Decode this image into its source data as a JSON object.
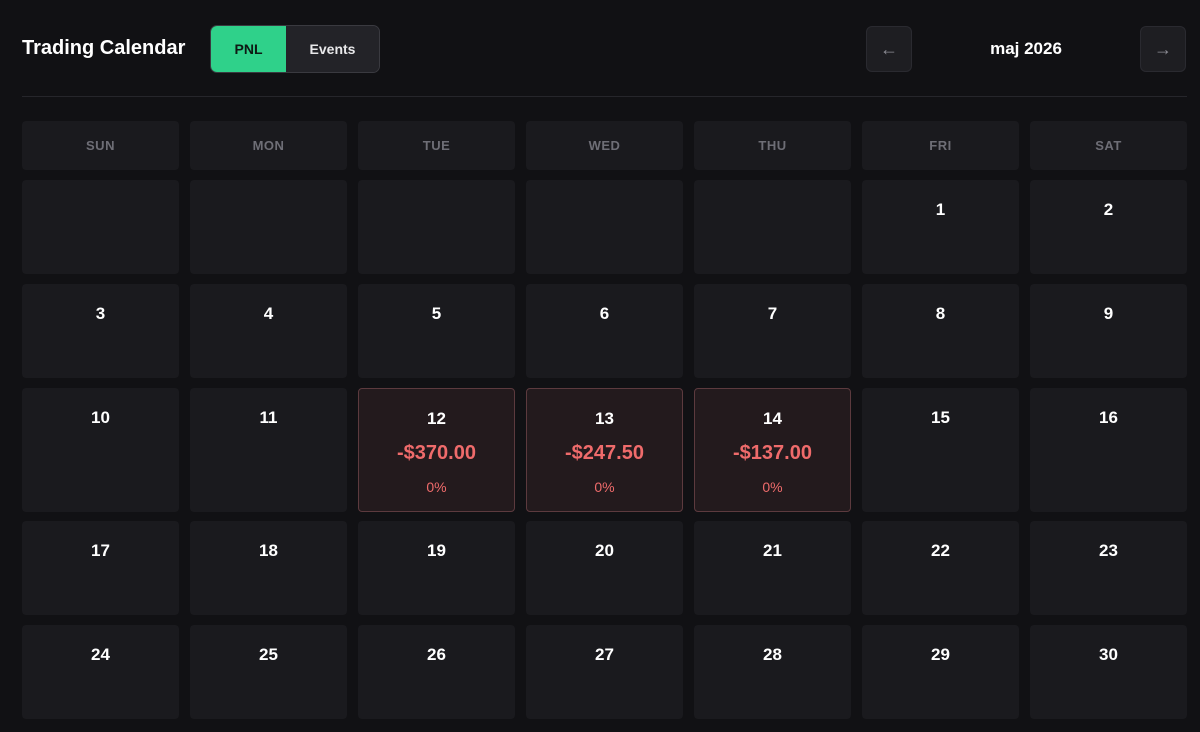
{
  "header": {
    "title": "Trading Calendar",
    "toggle": {
      "pnl_label": "PNL",
      "events_label": "Events",
      "active": "PNL"
    },
    "prev_label": "←",
    "next_label": "→",
    "month_label": "maj 2026"
  },
  "calendar": {
    "weekdays": [
      "SUN",
      "MON",
      "TUE",
      "WED",
      "THU",
      "FRI",
      "SAT"
    ],
    "weeks": [
      [
        {
          "day": ""
        },
        {
          "day": ""
        },
        {
          "day": ""
        },
        {
          "day": ""
        },
        {
          "day": ""
        },
        {
          "day": "1"
        },
        {
          "day": "2"
        }
      ],
      [
        {
          "day": "3"
        },
        {
          "day": "4"
        },
        {
          "day": "5"
        },
        {
          "day": "6"
        },
        {
          "day": "7"
        },
        {
          "day": "8"
        },
        {
          "day": "9"
        }
      ],
      [
        {
          "day": "10"
        },
        {
          "day": "11"
        },
        {
          "day": "12",
          "pnl": "-$370.00",
          "pct": "0%"
        },
        {
          "day": "13",
          "pnl": "-$247.50",
          "pct": "0%"
        },
        {
          "day": "14",
          "pnl": "-$137.00",
          "pct": "0%"
        },
        {
          "day": "15"
        },
        {
          "day": "16"
        }
      ],
      [
        {
          "day": "17"
        },
        {
          "day": "18"
        },
        {
          "day": "19"
        },
        {
          "day": "20"
        },
        {
          "day": "21"
        },
        {
          "day": "22"
        },
        {
          "day": "23"
        }
      ],
      [
        {
          "day": "24"
        },
        {
          "day": "25"
        },
        {
          "day": "26"
        },
        {
          "day": "27"
        },
        {
          "day": "28"
        },
        {
          "day": "29"
        },
        {
          "day": "30"
        }
      ]
    ]
  },
  "colors": {
    "accent": "#2fd18a",
    "loss": "#ef6b6b",
    "background": "#111114",
    "cell": "#1a1a1e"
  }
}
